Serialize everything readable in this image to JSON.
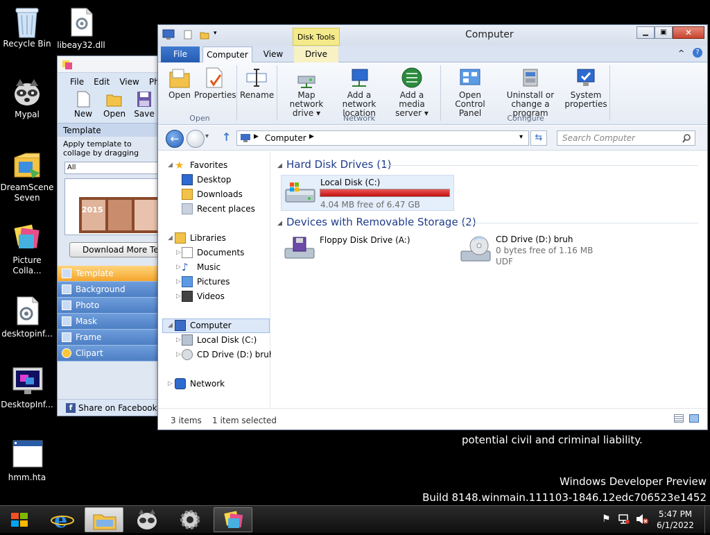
{
  "desktop": {
    "icons": [
      {
        "label": "Recycle Bin"
      },
      {
        "label": "libeay32.dll"
      },
      {
        "label": "Mypal"
      },
      {
        "label": "DreamScene Seven"
      },
      {
        "label": "Picture Colla..."
      },
      {
        "label": "desktopinf..."
      },
      {
        "label": "DesktopInf..."
      },
      {
        "label": "hmm.hta"
      }
    ],
    "watermark": {
      "line0": "potential civil and criminal liability.",
      "line1": "Windows Developer Preview",
      "line2": "Build 8148.winmain.111103-1846.12edc706523e1452"
    }
  },
  "collage_app": {
    "menu": [
      "File",
      "Edit",
      "View",
      "Phot"
    ],
    "tools": [
      "New",
      "Open",
      "Save"
    ],
    "section_title": "Template",
    "description": "Apply template to collage by dragging",
    "filter_value": "All",
    "preview_year": "2015",
    "download_button": "Download More Te",
    "panel_items": [
      "Template",
      "Background",
      "Photo",
      "Mask",
      "Frame",
      "Clipart"
    ],
    "share": "Share on Facebook"
  },
  "explorer": {
    "title": "Computer",
    "contextual_tab_group": "Disk Tools",
    "tabs": [
      "File",
      "Computer",
      "View",
      "Drive"
    ],
    "ribbon": {
      "open": "Open",
      "properties": "Properties",
      "rename": "Rename",
      "map_network_drive": "Map network drive",
      "add_network_location": "Add a network location",
      "add_media_server": "Add a media server",
      "open_control_panel": "Open Control Panel",
      "uninstall": "Uninstall or change a program",
      "system_properties": "System properties",
      "groups": [
        "Open",
        "Network",
        "Configure"
      ]
    },
    "address": {
      "path": "Computer",
      "search_placeholder": "Search Computer"
    },
    "nav": {
      "favorites": "Favorites",
      "desktop": "Desktop",
      "downloads": "Downloads",
      "recent": "Recent places",
      "libraries": "Libraries",
      "documents": "Documents",
      "music": "Music",
      "pictures": "Pictures",
      "videos": "Videos",
      "computer": "Computer",
      "local_disk": "Local Disk (C:)",
      "cd_drive": "CD Drive (D:) bruh",
      "network": "Network"
    },
    "content": {
      "hdd_header": "Hard Disk Drives (1)",
      "removable_header": "Devices with Removable Storage (2)",
      "local_disk": {
        "name": "Local Disk (C:)",
        "free": "4.04 MB free of 6.47 GB",
        "used_fraction": 0.9994
      },
      "floppy": {
        "name": "Floppy Disk Drive (A:)"
      },
      "cd": {
        "name": "CD Drive (D:) bruh",
        "free": "0 bytes free of 1.16 MB",
        "fs": "UDF"
      }
    },
    "status": {
      "items": "3 items",
      "selected": "1 item selected"
    }
  },
  "taskbar": {
    "time": "5:47 PM",
    "date": "6/1/2022"
  }
}
